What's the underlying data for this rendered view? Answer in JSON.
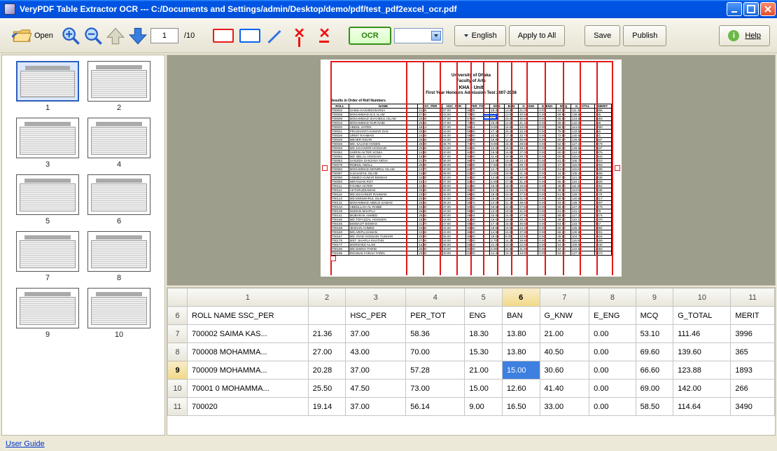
{
  "window": {
    "title": "VeryPDF Table Extractor OCR --- C:/Documents and Settings/admin/Desktop/demo/pdf/test_pdf2excel_ocr.pdf"
  },
  "toolbar": {
    "open_label": "Open",
    "page_current": "1",
    "page_total": "/10",
    "ocr_label": "OCR",
    "english_label": "English",
    "apply_label": "Apply to All",
    "save_label": "Save",
    "publish_label": "Publish",
    "help_label": "Help"
  },
  "thumbnails": {
    "selected": 1,
    "count": 10,
    "labels": [
      "1",
      "2",
      "3",
      "4",
      "5",
      "6",
      "7",
      "8",
      "9",
      "10"
    ]
  },
  "document": {
    "header_line1": "University of Dhaka",
    "header_line2": "Faculty of Arts",
    "header_line3": "KHA - Unit",
    "header_line4": "First Year Honours Admission Test 2007-2008",
    "subheader": "Results in Order of Roll Numbers",
    "columns": [
      "ROLL",
      "NAME",
      "SSC_PER",
      "HSC_PER",
      "PER_TOT",
      "ENG",
      "BAN",
      "G_KNW",
      "E_ENG",
      "MCQ",
      "G_TOTAL",
      "MERIT"
    ],
    "rows": [
      [
        "700002",
        "SAIMA KASHEM BARSA",
        "21.36",
        "37.00",
        "58.36",
        "18.30",
        "13.80",
        "21.00",
        "0.00",
        "53.10",
        "111.46",
        "3996"
      ],
      [
        "700008",
        "MOHAMMAD M.S ALAM",
        "27.00",
        "43.00",
        "70.00",
        "15.30",
        "13.80",
        "40.50",
        "0.00",
        "69.60",
        "139.60",
        "365"
      ],
      [
        "700009",
        "MOHAMMAD SHAHIDUL ISLAM",
        "20.28",
        "37.00",
        "57.28",
        "21.00",
        "15.00",
        "30.60",
        "0.00",
        "66.60",
        "123.88",
        "1893"
      ],
      [
        "700010",
        "MOHAMMAD NUR NABI",
        "25.50",
        "47.50",
        "73.00",
        "15.00",
        "12.60",
        "41.40",
        "0.00",
        "69.00",
        "142.00",
        "266"
      ],
      [
        "700020",
        "ABDUL SATEN",
        "19.14",
        "37.00",
        "56.14",
        "9.00",
        "16.50",
        "33.00",
        "0.00",
        "58.50",
        "114.64",
        "3490"
      ],
      [
        "700021",
        "PRASHANTA KUMAR DAS",
        "25.50",
        "43.00",
        "68.50",
        "17.40",
        "25.20",
        "32.40",
        "0.00",
        "75.00",
        "143.50",
        "215"
      ],
      [
        "700026",
        "URMY RAHMAN",
        "24.00",
        "44.00",
        "68.00",
        "22.50",
        "17.40",
        "32.70",
        "0.00",
        "72.60",
        "140.60",
        "321"
      ],
      [
        "700029",
        "MEHER NIGAR",
        "26.58",
        "43.00",
        "69.58",
        "16.80",
        "12.30",
        "30.90",
        "0.00",
        "60.00",
        "129.58",
        "1187"
      ],
      [
        "700046",
        "MD. SAJJAD HOSEN",
        "28.00",
        "46.70",
        "74.70",
        "9.00",
        "15.00",
        "28.50",
        "0.00",
        "52.50",
        "127.20",
        "1479"
      ],
      [
        "700049",
        "MD JAHANGIR HOSSAIN",
        "20.30",
        "43.00",
        "63.30",
        "12.00",
        "15.00",
        "38.10",
        "0.00",
        "66.10",
        "129.51",
        "1197"
      ],
      [
        "700052",
        "SHIRIN AKTER SONIA",
        "24.00",
        "40.00",
        "64.00",
        "16.50",
        "16.50",
        "27.00",
        "0.00",
        "60.00",
        "124.00",
        "1876"
      ],
      [
        "700062",
        "MD. BELAL HOSSAIN",
        "18.00",
        "37.00",
        "55.00",
        "11.40",
        "19.50",
        "29.70",
        "0.00",
        "60.60",
        "115.60",
        "3343"
      ],
      [
        "700063",
        "SANJIDA SANJANA NOVA",
        "21.78",
        "35.00",
        "56.78",
        "12.90",
        "15.90",
        "23.10",
        "0.00",
        "51.00",
        "106.78",
        "4810"
      ],
      [
        "700079",
        "ROBIUL AWALL",
        "29.30",
        "39.00",
        "68.30",
        "7.50",
        "9.00",
        "29.70",
        "0.00",
        "47.70",
        "115.90",
        "3293"
      ],
      [
        "700083",
        "MOHAMMAD MONIRUL ISLAM",
        "24.70",
        "40.00",
        "64.70",
        "14.70",
        "12.30",
        "24.00",
        "0.00",
        "51.90",
        "116.60",
        "3189"
      ],
      [
        "700087",
        "S.M.SAIFUL ISLAM",
        "24.30",
        "38.00",
        "62.30",
        "3.00",
        "19.80",
        "21.30",
        "0.00",
        "44.10",
        "106.40",
        "3559"
      ],
      [
        "700090",
        "ANIMES KUMAR BISWAS",
        "24.30",
        "40.00",
        "64.30",
        "13.50",
        "13.80",
        "30.00",
        "0.00",
        "57.00",
        "121.30",
        "2238"
      ],
      [
        "700093",
        "NIRANJAN ROY",
        "16.10",
        "37.00",
        "53.10",
        "6.00",
        "27.60",
        "31.20",
        "0.00",
        "65.40",
        "118.15",
        "2928"
      ],
      [
        "700111",
        "FAHIMA AKTER",
        "22.50",
        "39.00",
        "61.50",
        "15.00",
        "15.00",
        "19.50",
        "0.00",
        "49.50",
        "111.00",
        "4054"
      ],
      [
        "700112",
        "AKTARUZZAMAN",
        "25.00",
        "40.00",
        "65.00",
        "12.00",
        "12.60",
        "24.00",
        "0.00",
        "48.60",
        "113.60",
        "3635"
      ],
      [
        "700118",
        "MD.SHAHINUR RAHMAN",
        "23.20",
        "45.00",
        "68.20",
        "18.00",
        "16.00",
        "27.60",
        "0.00",
        "61.50",
        "129.70",
        "1175"
      ],
      [
        "700123",
        "MD.MONWARUL ISLM",
        "20.00",
        "40.00",
        "60.00",
        "16.00",
        "13.60",
        "31.00",
        "0.00",
        "60.60",
        "120.60",
        "2417"
      ],
      [
        "700131",
        "MOHAMMAD ABDUS SAMAD",
        "26.50",
        "39.20",
        "65.72",
        "12.00",
        "11.40",
        "39.60",
        "0.00",
        "63.00",
        "128.72",
        "1297"
      ],
      [
        "700134",
        "ABDULLAH-AL-RABBI",
        "23.30",
        "37.00",
        "60.30",
        "16.50",
        "22.80",
        "27.60",
        "0.00",
        "66.90",
        "127.20",
        "1478"
      ],
      [
        "700139",
        "NUMAN MAHFUJ",
        "26.80",
        "43.00",
        "69.80",
        "12.00",
        "18.00",
        "31.50",
        "0.00",
        "61.50",
        "131.14",
        "979"
      ],
      [
        "700141",
        "MUBARAK AHMED",
        "28.44",
        "40.00",
        "68.44",
        "15.90",
        "15.00",
        "27.90",
        "0.00",
        "58.80",
        "127.24",
        "1474"
      ],
      [
        "700155",
        "MD.TOFAZZAL HOSSZIN",
        "18.30",
        "43.00",
        "61.30",
        "15.00",
        "10.50",
        "20.40",
        "0.00",
        "49.10",
        "110.10",
        "4070"
      ],
      [
        "700156",
        "BISWAJIT BISWAS",
        "21.70",
        "47.50",
        "69.20",
        "17.40",
        "16.50",
        "30.60",
        "0.00",
        "64.50",
        "133.70",
        "817"
      ],
      [
        "700158",
        "JESHAN AHMED",
        "23.80",
        "42.00",
        "65.80",
        "19.50",
        "16.50",
        "24.30",
        "0.00",
        "60.30",
        "125.34",
        "1984"
      ],
      [
        "700160",
        "MD.ARIFUJJAMAN",
        "22.40",
        "43.00",
        "65.40",
        "14.90",
        "15.50",
        "37.80",
        "0.00",
        "68.20",
        "130.90",
        "1001"
      ],
      [
        "700167",
        "MD. RIAD HOSSAIN TUSHAR",
        "20.20",
        "35.00",
        "55.20",
        "18.00",
        "9.00",
        "22.50",
        "0.00",
        "49.50",
        "104.70",
        "4224"
      ],
      [
        "700176",
        "MST. SHAPLA KHATUN",
        "27.00",
        "43.00",
        "70.00",
        "2.70",
        "15.30",
        "28.80",
        "0.00",
        "46.80",
        "116.80",
        "3159"
      ],
      [
        "700177",
        "MORSHED ALAM",
        "16.90",
        "38.00",
        "55.10",
        "21.00",
        "10.50",
        "22.50",
        "0.00",
        "54.00",
        "109.50",
        "4240"
      ],
      [
        "700190",
        "MD.SHEKH FARID",
        "20.00",
        "40.00",
        "60.00",
        "6.00",
        "24.90",
        "31.80",
        "0.00",
        "62.70",
        "122.50",
        "2093"
      ],
      [
        "700195",
        "ROUNAK FARAH TARIN",
        "23.00",
        "40.00",
        "63.00",
        "14.40",
        "15.30",
        "34.80",
        "0.00",
        "64.10",
        "127.30",
        "1473"
      ]
    ]
  },
  "spreadsheet": {
    "col_headers": [
      "1",
      "2",
      "3",
      "4",
      "5",
      "6",
      "7",
      "8",
      "9",
      "10",
      "11"
    ],
    "active_col_index": 5,
    "active_row_header": "9",
    "rows": [
      {
        "hdr": "6",
        "cells": [
          "ROLL NAME SSC_PER",
          "",
          "HSC_PER",
          "PER_TOT",
          "ENG",
          "BAN",
          "G_KNW",
          "E_ENG",
          "MCQ",
          "G_TOTAL",
          "MERIT"
        ]
      },
      {
        "hdr": "7",
        "cells": [
          "700002 SAIMA KAS...",
          "21.36",
          "37.00",
          "58.36",
          "18.30",
          "13.80",
          "21.00",
          "0.00",
          "53.10",
          "111.46",
          "3996"
        ]
      },
      {
        "hdr": "8",
        "cells": [
          "700008 MOHAMMA...",
          "27.00",
          "43.00",
          "70.00",
          "15.30",
          "13.80",
          "40.50",
          "0.00",
          "69.60",
          "139.60",
          "365"
        ]
      },
      {
        "hdr": "9",
        "cells": [
          "700009 MOHAMMA...",
          "20.28",
          "37.00",
          "57.28",
          "21.00",
          "15.00",
          "30.60",
          "0.00",
          "66.60",
          "123.88",
          "1893"
        ]
      },
      {
        "hdr": "10",
        "cells": [
          "70001 0 MOHAMMA...",
          "25.50",
          "47.50",
          "73.00",
          "15.00",
          "12.60",
          "41.40",
          "0.00",
          "69.00",
          "142.00",
          "266"
        ]
      },
      {
        "hdr": "11",
        "cells": [
          "700020",
          "19.14",
          "37.00",
          "56.14",
          "9.00",
          "16.50",
          "33.00",
          "0.00",
          "58.50",
          "114.64",
          "3490"
        ]
      }
    ],
    "selected": {
      "row_index": 3,
      "col_index": 5
    }
  },
  "footer": {
    "user_guide": "User Guide"
  }
}
